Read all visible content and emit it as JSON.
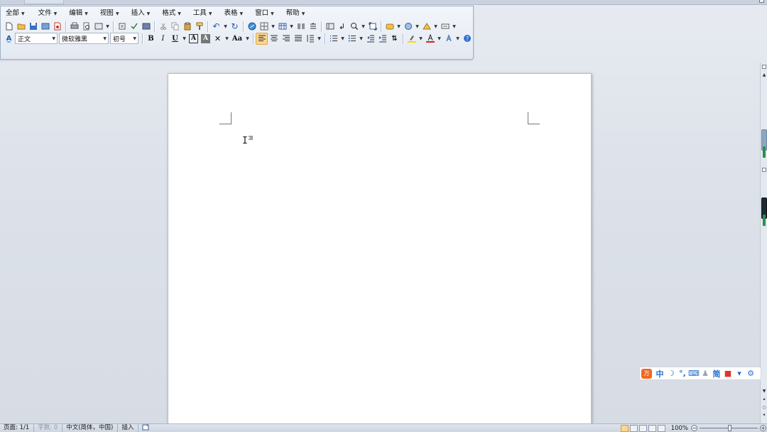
{
  "menubar": [
    {
      "label": "全部"
    },
    {
      "label": "文件"
    },
    {
      "label": "编辑"
    },
    {
      "label": "视图"
    },
    {
      "label": "插入"
    },
    {
      "label": "格式"
    },
    {
      "label": "工具"
    },
    {
      "label": "表格"
    },
    {
      "label": "窗口"
    },
    {
      "label": "帮助"
    }
  ],
  "formatting": {
    "style": "正文",
    "font": "微软雅黑",
    "size": "初号",
    "bold": "B",
    "italic": "I",
    "underline": "U",
    "char_border": "A",
    "char_shade": "A",
    "change_case": "Aa"
  },
  "ime": {
    "logo": "万",
    "mode": "中",
    "simplified": "简"
  },
  "status": {
    "page": "页面: 1/1",
    "words": "字数: 0",
    "language": "中文(简体，中国)",
    "mode": "插入",
    "zoom": "100%"
  },
  "colors": {
    "page_bg": "#ffffff",
    "highlight_bar": "#ffd700",
    "font_color_bar": "#e02020",
    "ime_accent": "#1f6fd1",
    "ime_logo": "#f06922"
  }
}
